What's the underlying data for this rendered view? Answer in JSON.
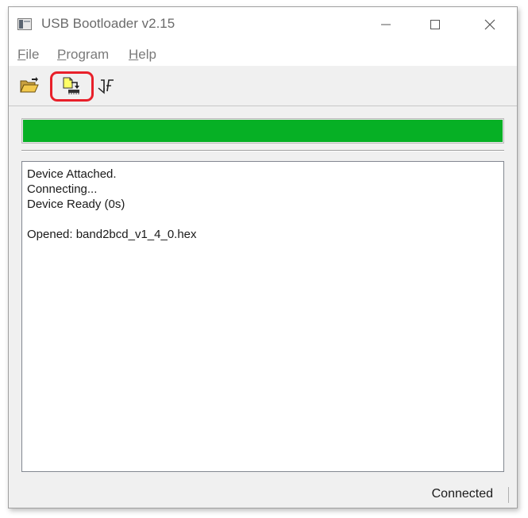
{
  "window": {
    "title": "USB Bootloader v2.15"
  },
  "menu": [
    {
      "label": "File",
      "accel": "F",
      "rest": "ile"
    },
    {
      "label": "Program",
      "accel": "P",
      "rest": "rogram"
    },
    {
      "label": "Help",
      "accel": "H",
      "rest": "elp"
    }
  ],
  "toolbar": {
    "tools": [
      "open-folder-icon",
      "program-device-icon",
      "reset-device-icon"
    ],
    "highlighted": "program-device-icon"
  },
  "progress": {
    "fraction": 1.0,
    "color": "#06b025"
  },
  "log": {
    "lines": [
      "Device Attached.",
      "Connecting...",
      "Device Ready (0s)",
      "",
      "Opened: band2bcd_v1_4_0.hex"
    ]
  },
  "status": {
    "text": "Connected"
  },
  "colors": {
    "highlight_ring": "#e8202a"
  }
}
